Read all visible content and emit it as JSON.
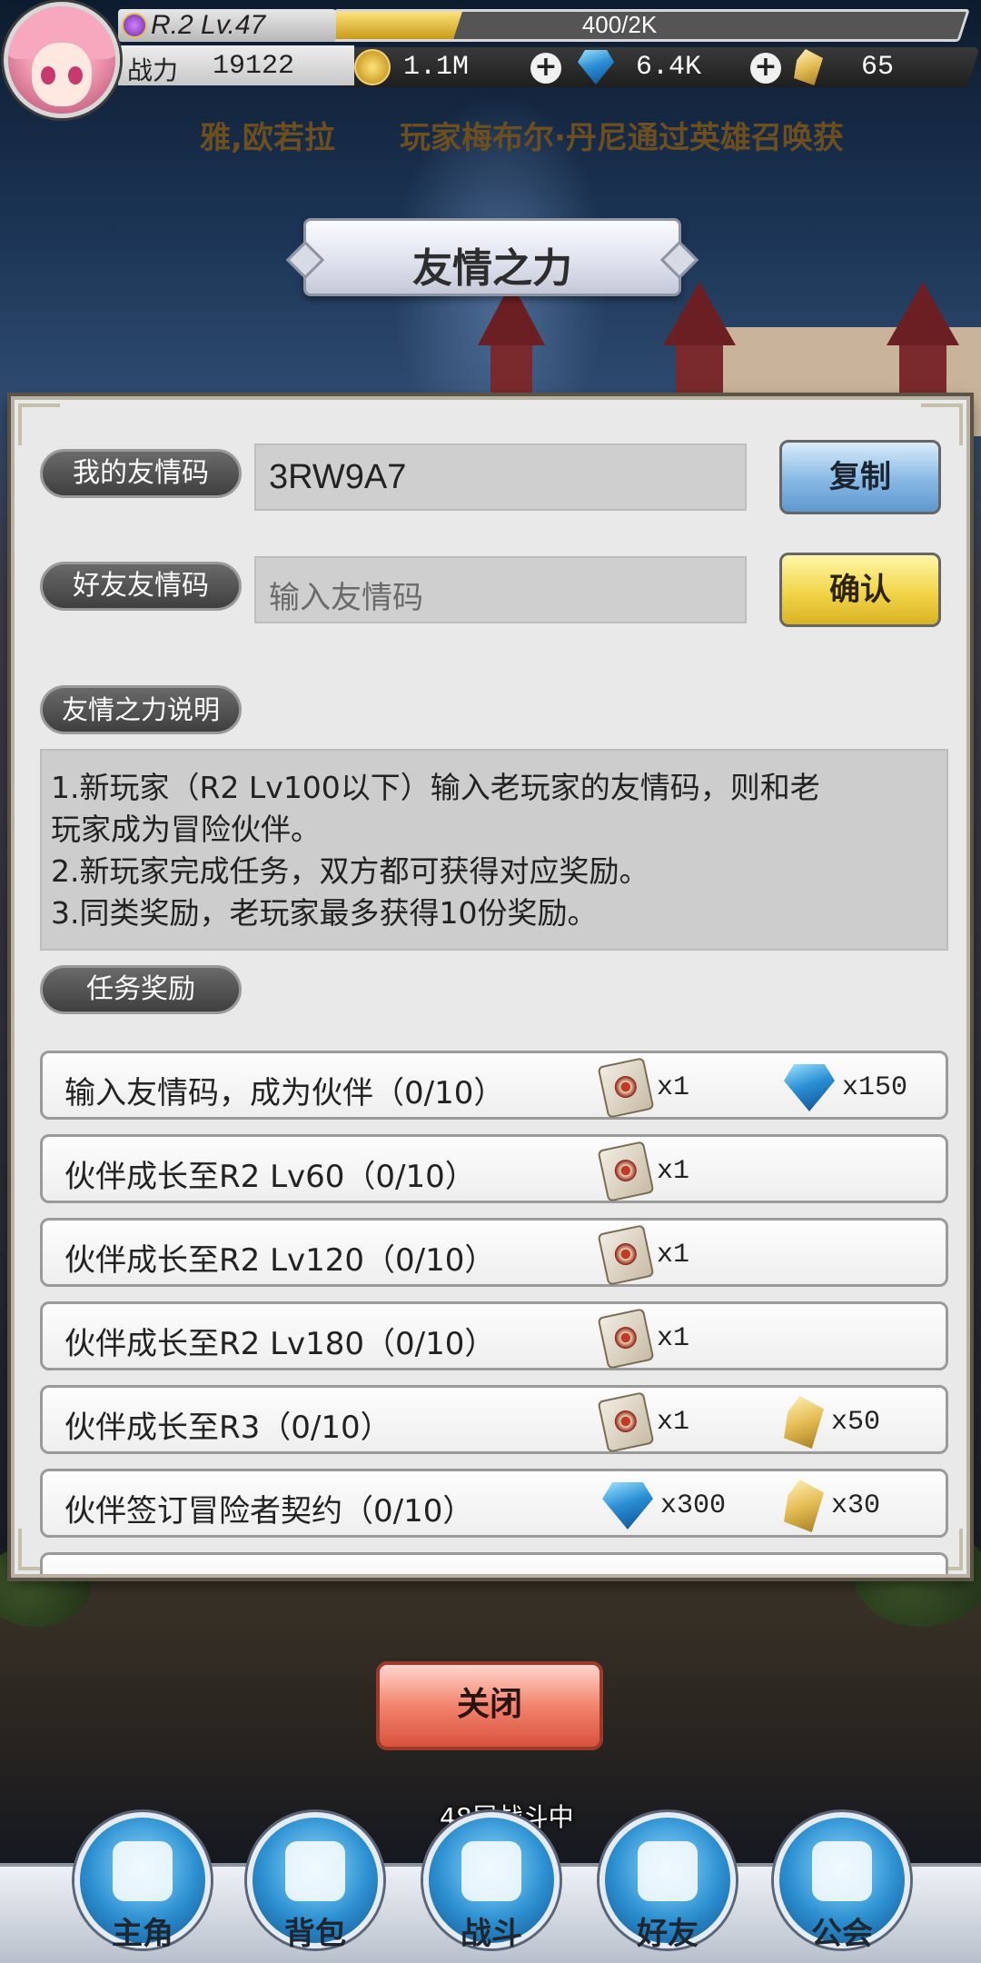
{
  "hud": {
    "level": "R.2 Lv.47",
    "exp_text": "400/2K",
    "exp_fraction": 0.2,
    "power_label": "战力",
    "power_value": "19122",
    "gold": "1.1M",
    "diamonds": "6.4K",
    "shards": "65"
  },
  "marquee": {
    "left_text": "雅,欧若拉",
    "right_text": "玩家梅布尔·丹尼通过英雄召唤获"
  },
  "title": "友情之力",
  "my_code": {
    "label": "我的友情码",
    "value": "3RW9A7",
    "copy_button": "复制"
  },
  "friend_code": {
    "label": "好友友情码",
    "placeholder": "输入友情码",
    "confirm_button": "确认"
  },
  "description": {
    "label": "友情之力说明",
    "lines": [
      "1.新玩家（R2 Lv100以下）输入老玩家的友情码，则和老",
      "玩家成为冒险伙伴。",
      "2.新玩家完成任务，双方都可获得对应奖励。",
      "3.同类奖励，老玩家最多获得10份奖励。"
    ]
  },
  "rewards": {
    "label": "任务奖励",
    "tasks": [
      {
        "text": "输入友情码，成为伙伴（0/10）",
        "r1_icon": "card-icon",
        "r1_count": "x1",
        "r2_icon": "diamond-icon",
        "r2_count": "x150"
      },
      {
        "text": "伙伴成长至R2 Lv60（0/10）",
        "r1_icon": "card-icon",
        "r1_count": "x1",
        "r2_icon": "",
        "r2_count": ""
      },
      {
        "text": "伙伴成长至R2 Lv120（0/10）",
        "r1_icon": "card-icon",
        "r1_count": "x1",
        "r2_icon": "",
        "r2_count": ""
      },
      {
        "text": "伙伴成长至R2 Lv180（0/10）",
        "r1_icon": "card-icon",
        "r1_count": "x1",
        "r2_icon": "",
        "r2_count": ""
      },
      {
        "text": "伙伴成长至R3（0/10）",
        "r1_icon": "card-icon",
        "r1_count": "x1",
        "r2_icon": "shard-icon",
        "r2_count": "x50"
      },
      {
        "text": "伙伴签订冒险者契约（0/10）",
        "r1_icon": "diamond-icon",
        "r1_count": "x300",
        "r2_icon": "shard-icon",
        "r2_count": "x30"
      }
    ]
  },
  "close_button": "关闭",
  "battle_status": "48层战斗中",
  "nav": [
    {
      "label": "主角",
      "icon": "helmet-icon"
    },
    {
      "label": "背包",
      "icon": "backpack-icon"
    },
    {
      "label": "战斗",
      "icon": "crossed-swords-icon"
    },
    {
      "label": "好友",
      "icon": "handshake-icon"
    },
    {
      "label": "公会",
      "icon": "guild-lock-icon"
    }
  ],
  "colors": {
    "copy_button": "#87b8e4",
    "confirm_button": "#f3d548",
    "close_button": "#f2836e",
    "nav_button": "#2c8fd0"
  }
}
